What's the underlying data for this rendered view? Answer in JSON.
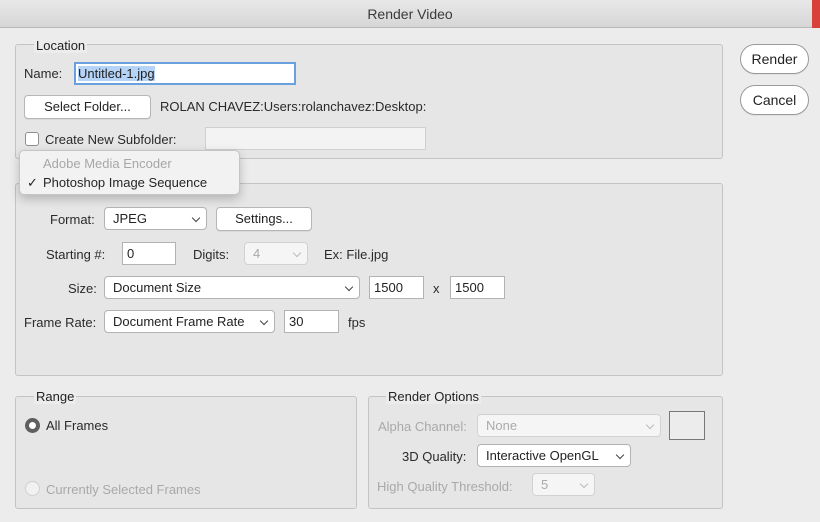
{
  "window": {
    "title": "Render Video"
  },
  "location": {
    "group_title": "Location",
    "name_label": "Name:",
    "name_value_selected": "Untitled-1",
    "name_value_rest": ".jpg",
    "select_folder_button": "Select Folder...",
    "folder_path": "ROLAN CHAVEZ:Users:rolanchavez:Desktop:",
    "create_subfolder_label": "Create New Subfolder:",
    "create_subfolder_checked": false,
    "subfolder_value": ""
  },
  "actions": {
    "render_button": "Render",
    "cancel_button": "Cancel"
  },
  "render_type_menu": {
    "items": [
      {
        "label": "Adobe Media Encoder",
        "enabled": false,
        "checked": false
      },
      {
        "label": "Photoshop Image Sequence",
        "enabled": true,
        "checked": true
      }
    ],
    "check_glyph": "✓"
  },
  "sequence": {
    "format_label": "Format:",
    "format_value": "JPEG",
    "settings_button": "Settings...",
    "starting_label": "Starting #:",
    "starting_value": "0",
    "digits_label": "Digits:",
    "digits_value": "4",
    "example_text": "Ex: File.jpg",
    "size_label": "Size:",
    "size_value": "Document Size",
    "width_value": "1500",
    "x_label": "x",
    "height_value": "1500",
    "frame_rate_label": "Frame Rate:",
    "frame_rate_value": "Document Frame Rate",
    "fps_value": "30",
    "fps_label": "fps"
  },
  "range": {
    "group_title": "Range",
    "all_frames_label": "All Frames",
    "all_frames_selected": true,
    "current_frames_label": "Currently Selected Frames",
    "current_frames_enabled": false
  },
  "render_options": {
    "group_title": "Render Options",
    "alpha_label": "Alpha Channel:",
    "alpha_value": "None",
    "quality_label": "3D Quality:",
    "quality_value": "Interactive OpenGL",
    "threshold_label": "High Quality Threshold:",
    "threshold_value": "5"
  },
  "colors": {
    "accent_focus": "#6aa0de",
    "selection": "#b4d3f7",
    "dialog_bg": "#ececec"
  }
}
